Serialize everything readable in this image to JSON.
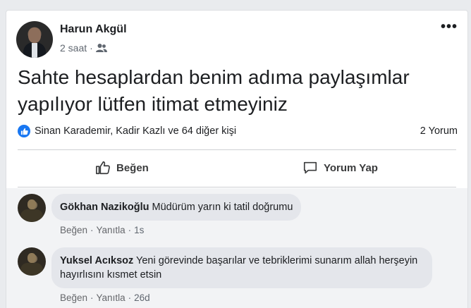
{
  "post": {
    "author": "Harun Akgül",
    "time": "2 saat",
    "dot": "·",
    "more": "•••",
    "text": "Sahte hesaplardan benim adıma paylaşımlar yapılıyor lütfen itimat etmeyiniz",
    "reactions_text": "Sinan Karademir, Kadir Kazlı ve 64 diğer kişi",
    "comment_count": "2 Yorum",
    "like_label": "Beğen",
    "comment_label": "Yorum Yap"
  },
  "comments": [
    {
      "name": "Gökhan Nazikoğlu",
      "text": "Müdürüm yarın ki tatil doğrumu",
      "like": "Beğen",
      "reply": "Yanıtla",
      "sep": "·",
      "time": "1s"
    },
    {
      "name": "Yuksel Acıksoz",
      "text": "Yeni görevinde başarılar ve tebriklerimi sunarım allah herşeyin hayırlısını kısmet etsin",
      "like": "Beğen",
      "reply": "Yanıtla",
      "sep": "·",
      "time": "26d"
    }
  ],
  "colors": {
    "accent": "#1877f2",
    "bubble": "#e4e6eb",
    "muted": "#606770"
  },
  "icons": [
    "audience-friends-icon",
    "like-reaction-icon",
    "thumbs-up-icon",
    "comment-icon",
    "more-options-icon"
  ]
}
